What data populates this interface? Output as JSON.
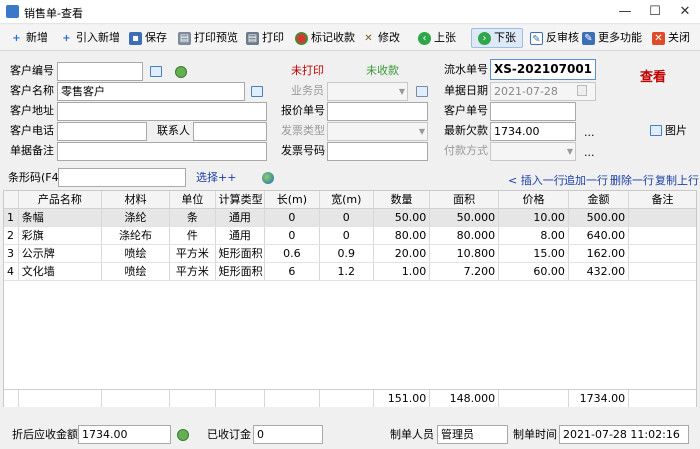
{
  "window": {
    "title": "销售单-查看"
  },
  "toolbar": {
    "new": "新增",
    "import_new": "引入新增",
    "save": "保存",
    "print_preview": "打印预览",
    "print": "打印",
    "mark_received": "标记收款",
    "edit": "修改",
    "prev": "上张",
    "next": "下张",
    "unaudit": "反审核",
    "more": "更多功能",
    "close": "关闭"
  },
  "form": {
    "customer_code_label": "客户编号",
    "customer_code": "",
    "customer_name_label": "客户名称",
    "customer_name": "零售客户",
    "customer_address_label": "客户地址",
    "customer_address": "",
    "customer_phone_label": "客户电话",
    "customer_phone": "",
    "contact_label": "联系人",
    "contact": "",
    "remark_label": "单据备注",
    "remark": "",
    "print_status": "未打印",
    "receipt_status": "未收款",
    "salesman_label": "业务员",
    "quote_no_label": "报价单号",
    "invoice_type_label": "发票类型",
    "invoice_no_label": "发票号码",
    "serial_label": "流水单号",
    "serial": "XS-202107001",
    "date_label": "单据日期",
    "date": "2021-07-28",
    "customer_order_label": "客户单号",
    "customer_order": "",
    "latest_debt_label": "最新欠款",
    "latest_debt": "1734.00",
    "payment_label": "付款方式",
    "view_stamp": "查看",
    "image_label": "图片",
    "barcode_label": "条形码(F4)",
    "select_label": "选择++",
    "insert_row": "< 插入一行",
    "append_row": "追加一行",
    "delete_row": "删除一行",
    "copy_row": "复制上行"
  },
  "table": {
    "headers": [
      "",
      "产品名称",
      "材料",
      "单位",
      "计算类型",
      "长(m)",
      "宽(m)",
      "数量",
      "面积",
      "价格",
      "金额",
      "备注"
    ],
    "rows": [
      [
        "1",
        "条幅",
        "涤纶",
        "条",
        "通用",
        "0",
        "0",
        "50.00",
        "50.000",
        "10.00",
        "500.00",
        ""
      ],
      [
        "2",
        "彩旗",
        "涤纶布",
        "件",
        "通用",
        "0",
        "0",
        "80.00",
        "80.000",
        "8.00",
        "640.00",
        ""
      ],
      [
        "3",
        "公示牌",
        "喷绘",
        "平方米",
        "矩形面积",
        "0.6",
        "0.9",
        "20.00",
        "10.800",
        "15.00",
        "162.00",
        ""
      ],
      [
        "4",
        "文化墙",
        "喷绘",
        "平方米",
        "矩形面积",
        "6",
        "1.2",
        "1.00",
        "7.200",
        "60.00",
        "432.00",
        ""
      ]
    ],
    "totals": {
      "quantity": "151.00",
      "area": "148.000",
      "amount": "1734.00"
    }
  },
  "footer": {
    "discounted_label": "折后应收金额",
    "discounted": "1734.00",
    "deposit_label": "已收订金",
    "deposit": "0",
    "creator_label": "制单人员",
    "creator": "管理员",
    "time_label": "制单时间",
    "time": "2021-07-28 11:02:16"
  }
}
